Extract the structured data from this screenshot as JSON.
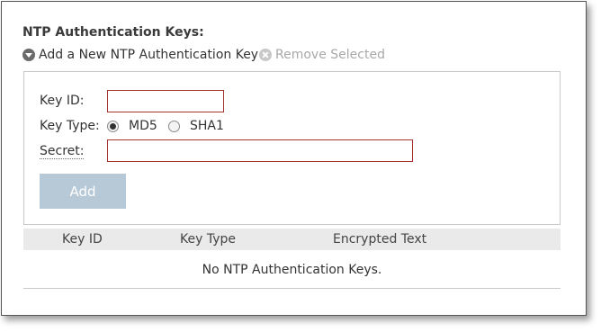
{
  "section": {
    "title": "NTP Authentication Keys:"
  },
  "actions": {
    "add_label": "Add a New NTP Authentication Key",
    "remove_label": "Remove Selected"
  },
  "form": {
    "key_id_label": "Key ID:",
    "key_id_value": "",
    "key_type_label": "Key Type:",
    "key_type_options": [
      "MD5",
      "SHA1"
    ],
    "key_type_selected": "MD5",
    "secret_label": "Secret:",
    "secret_value": "",
    "add_button_label": "Add"
  },
  "table": {
    "columns": [
      "Key ID",
      "Key Type",
      "Encrypted Text"
    ],
    "rows": [],
    "empty_message": "No NTP Authentication Keys."
  },
  "colors": {
    "input_border": "#a4332f",
    "add_button_bg": "#b7c8d7",
    "header_bg": "#eaeaea",
    "disabled_text": "#a8a8a8"
  }
}
